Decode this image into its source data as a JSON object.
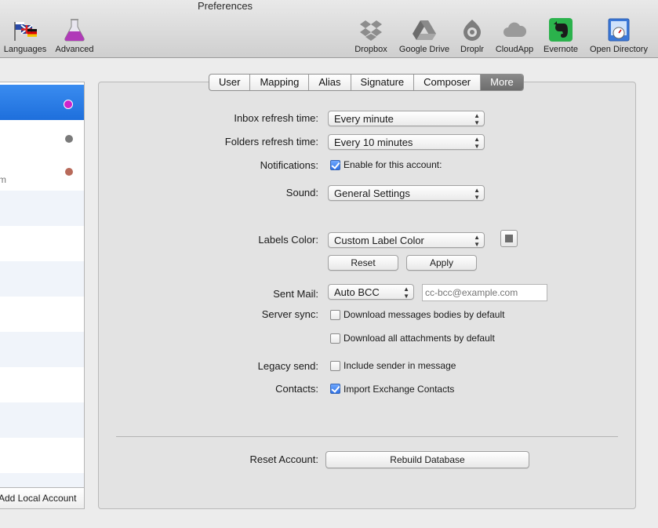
{
  "window": {
    "title": "Preferences"
  },
  "toolbar": {
    "left_items": [
      {
        "label": "Languages",
        "icon": "flags-icon"
      },
      {
        "label": "Advanced",
        "icon": "flask-icon"
      }
    ],
    "right_items": [
      {
        "label": "Dropbox",
        "icon": "dropbox-icon"
      },
      {
        "label": "Google Drive",
        "icon": "google-drive-icon"
      },
      {
        "label": "Droplr",
        "icon": "droplr-icon"
      },
      {
        "label": "CloudApp",
        "icon": "cloud-icon"
      },
      {
        "label": "Evernote",
        "icon": "evernote-icon"
      },
      {
        "label": "Open Directory",
        "icon": "open-directory-icon"
      }
    ]
  },
  "accounts": {
    "colors": [
      "#cc22cc",
      "#7a7a7a",
      "#b86a5a"
    ],
    "second_line_text": "m",
    "add_local_label": "Add Local Account"
  },
  "tabs": [
    "User",
    "Mapping",
    "Alias",
    "Signature",
    "Composer",
    "More"
  ],
  "active_tab": "More",
  "form": {
    "inbox_refresh": {
      "label": "Inbox refresh time:",
      "value": "Every minute"
    },
    "folders_refresh": {
      "label": "Folders refresh time:",
      "value": "Every 10 minutes"
    },
    "notifications": {
      "label": "Notifications:",
      "checkbox_label": "Enable for this account:",
      "checked": true
    },
    "sound": {
      "label": "Sound:",
      "value": "General Settings"
    },
    "labels_color": {
      "label": "Labels Color:",
      "value": "Custom Label Color",
      "swatch_color": "#6d6d6d",
      "reset_label": "Reset",
      "apply_label": "Apply"
    },
    "sent_mail": {
      "label": "Sent Mail:",
      "value": "Auto BCC",
      "placeholder": "cc-bcc@example.com"
    },
    "server_sync": {
      "label": "Server sync:",
      "option1": {
        "label": "Download messages bodies by default",
        "checked": false
      },
      "option2": {
        "label": "Download all attachments by default",
        "checked": false
      }
    },
    "legacy_send": {
      "label": "Legacy send:",
      "checkbox_label": "Include sender in message",
      "checked": false
    },
    "contacts": {
      "label": "Contacts:",
      "checkbox_label": "Import Exchange Contacts",
      "checked": true
    },
    "reset_account": {
      "label": "Reset Account:",
      "button_label": "Rebuild Database"
    }
  }
}
